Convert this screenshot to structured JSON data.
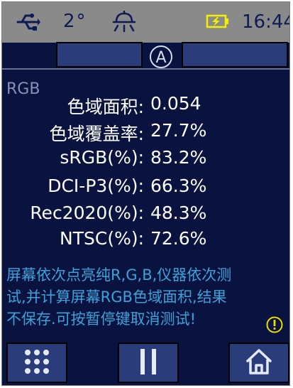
{
  "status_bar": {
    "usb_icon": "usb-icon",
    "temperature": "2°",
    "mirror_icon": "mirror-light-icon",
    "battery_icon": "battery-charging-icon",
    "time": "16:44"
  },
  "toolbar": {
    "mode_indicator": "A"
  },
  "mode": "RGB",
  "results": [
    {
      "label": "色域面积:",
      "value": "0.054"
    },
    {
      "label": "色域覆盖率:",
      "value": "27.7%"
    },
    {
      "label": "sRGB(%):",
      "value": "83.2%"
    },
    {
      "label": "DCI-P3(%):",
      "value": "66.3%"
    },
    {
      "label": "Rec2020(%):",
      "value": "48.3%"
    },
    {
      "label": "NTSC(%):",
      "value": "72.6%"
    }
  ],
  "message": {
    "line1": "屏幕依次点亮纯R,G,B,仪器依次测",
    "line2": "试,并计算屏幕RGB色域面积,结果",
    "line3": "不保存.可按暂停键取消测试!"
  },
  "colors": {
    "background": "#0a1340",
    "status_bar": "#8a8a8a",
    "button": "#2a3d7a",
    "message_text": "#3ba3d8",
    "warning": "#e8e000"
  },
  "bottom_bar": {
    "menu_icon": "grid-menu-icon",
    "pause_icon": "pause-icon",
    "home_icon": "home-icon"
  }
}
